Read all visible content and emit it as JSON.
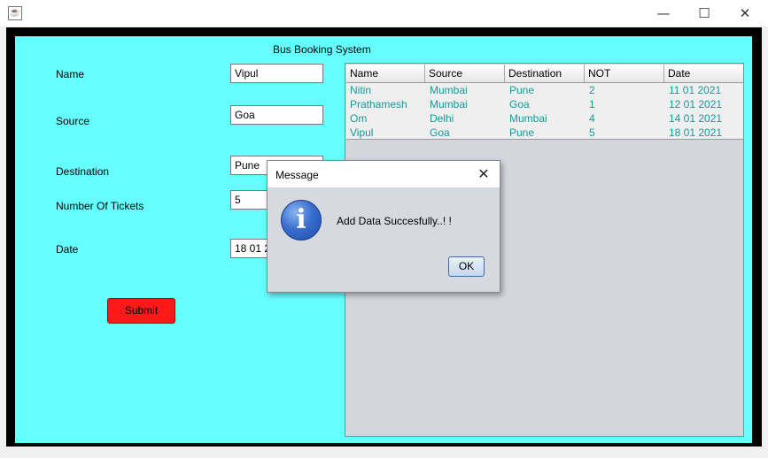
{
  "window": {
    "minimize_glyph": "—",
    "maximize_glyph": "☐",
    "close_glyph": "✕"
  },
  "app": {
    "title": "Bus Booking System"
  },
  "form": {
    "name_label": "Name",
    "name_value": "Vipul",
    "source_label": "Source",
    "source_value": "Goa",
    "destination_label": "Destination",
    "destination_value": "Pune",
    "tickets_label": "Number Of Tickets",
    "tickets_value": "5",
    "date_label": "Date",
    "date_value": "18 01 2021",
    "submit_label": "Submit"
  },
  "table": {
    "columns": [
      "Name",
      "Source",
      "Destination",
      "NOT",
      "Date"
    ],
    "rows": [
      [
        "Nitin",
        "Mumbai",
        "Pune",
        "2",
        "11 01 2021"
      ],
      [
        "Prathamesh",
        "Mumbai",
        "Goa",
        "1",
        "12 01 2021"
      ],
      [
        "Om",
        "Delhi",
        "Mumbai",
        "4",
        "14 01 2021"
      ],
      [
        "Vipul",
        "Goa",
        "Pune",
        "5",
        "18 01 2021"
      ]
    ]
  },
  "dialog": {
    "title": "Message",
    "close_glyph": "✕",
    "message": "Add Data Succesfully..! !",
    "icon_glyph": "i",
    "ok_label": "OK"
  },
  "colors": {
    "panel_bg": "#66ffff",
    "submit_bg": "#ff1a1a",
    "table_text": "#159a9a"
  },
  "icons": {
    "app": "java-icon",
    "dialog": "info-icon"
  }
}
